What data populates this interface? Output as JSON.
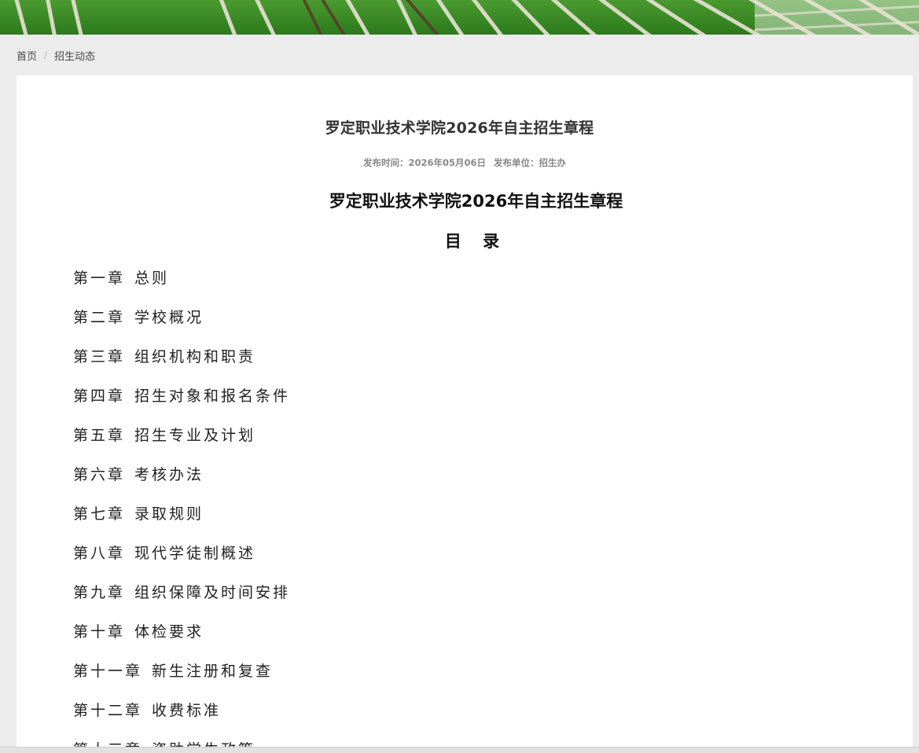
{
  "breadcrumb": {
    "home": "首页",
    "separator": "/",
    "current": "招生动态"
  },
  "article": {
    "title": "罗定职业技术学院2026年自主招生章程",
    "publish_time": "发布时间：2026年05月06日",
    "publish_unit": "发布单位：招生办",
    "doc_title": "罗定职业技术学院2026年自主招生章程",
    "toc_heading": "目 录"
  },
  "toc": [
    {
      "chapter": "第一章",
      "name": "总则"
    },
    {
      "chapter": "第二章",
      "name": "学校概况"
    },
    {
      "chapter": "第三章",
      "name": "组织机构和职责"
    },
    {
      "chapter": "第四章",
      "name": "招生对象和报名条件"
    },
    {
      "chapter": "第五章",
      "name": "招生专业及计划"
    },
    {
      "chapter": "第六章",
      "name": "考核办法"
    },
    {
      "chapter": "第七章",
      "name": "录取规则"
    },
    {
      "chapter": "第八章",
      "name": "现代学徒制概述"
    },
    {
      "chapter": "第九章",
      "name": "组织保障及时间安排"
    },
    {
      "chapter": "第十章",
      "name": "体检要求"
    },
    {
      "chapter": "第十一章",
      "name": "新生注册和复查"
    },
    {
      "chapter": "第十二章",
      "name": "收费标准"
    },
    {
      "chapter": "第十三章",
      "name": "资助学生政策"
    }
  ],
  "colors": {
    "page_bg": "#ececec",
    "card_bg": "#ffffff",
    "banner_grass": "#2f7a1f"
  }
}
